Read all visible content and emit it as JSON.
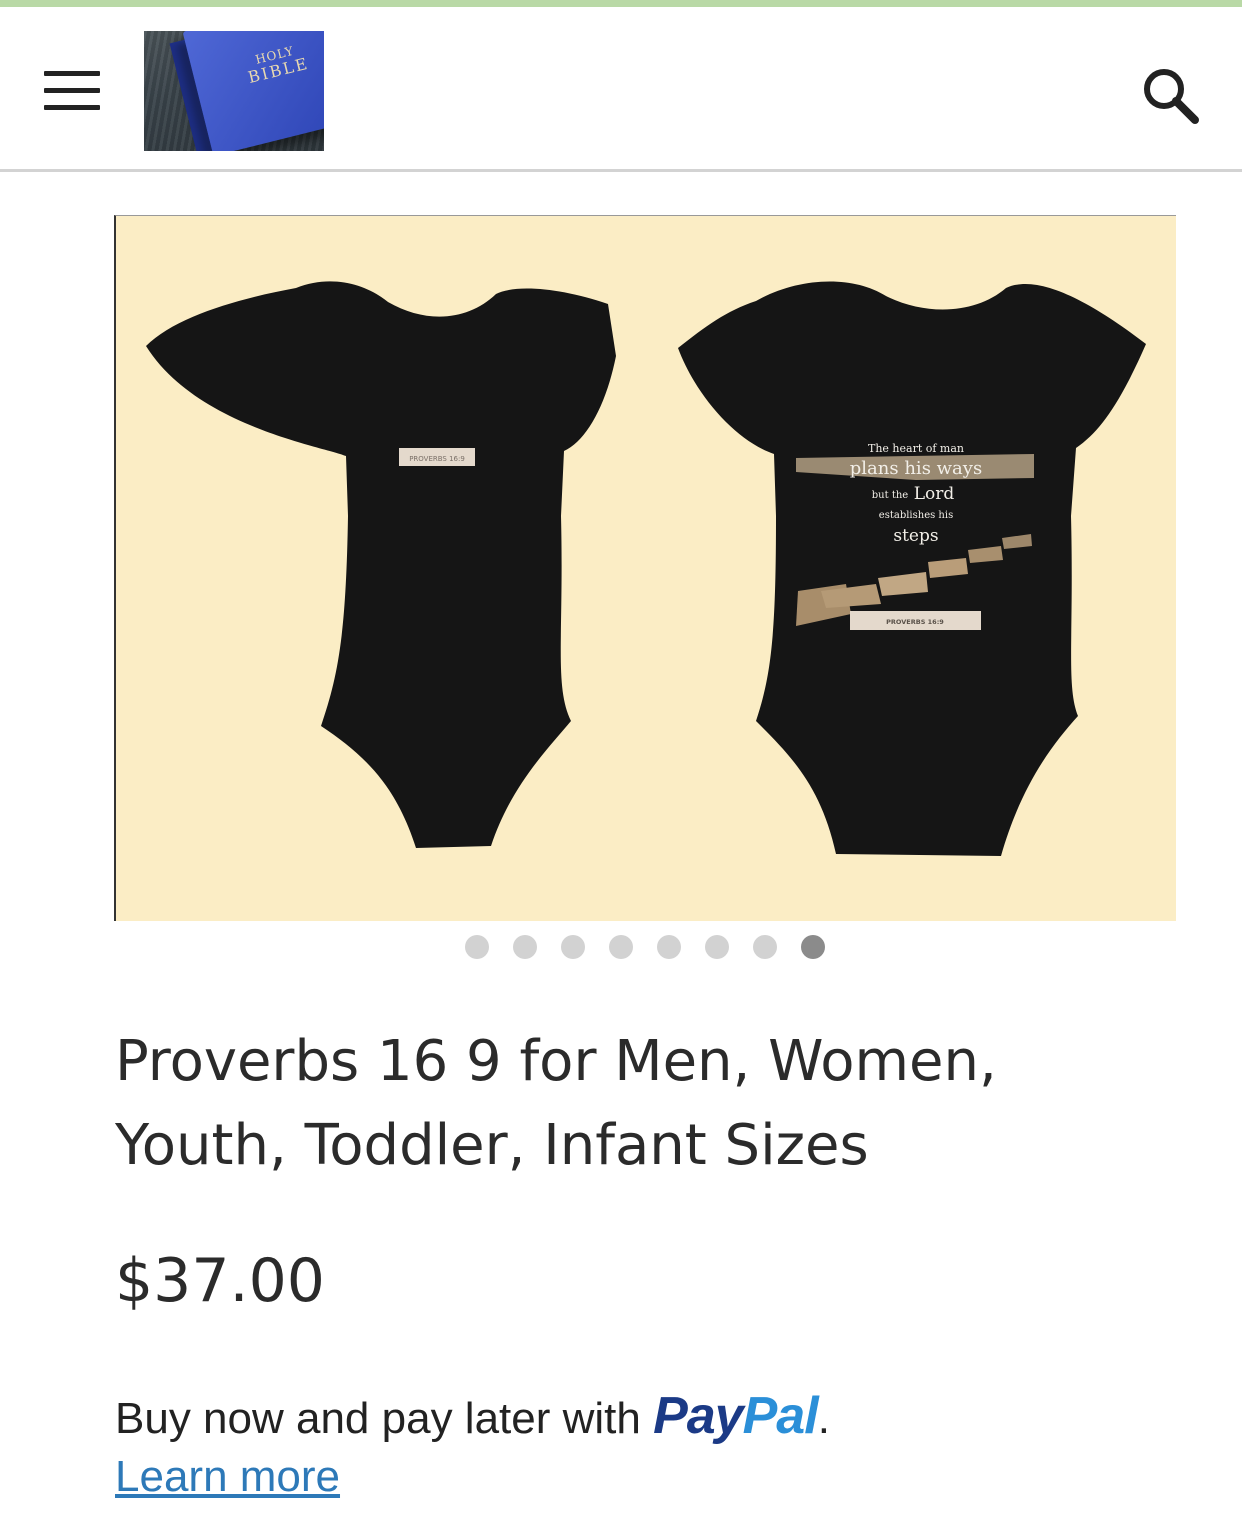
{
  "header": {
    "menu_icon": "hamburger-menu-icon",
    "logo": {
      "line1": "HOLY",
      "line2": "BIBLE"
    },
    "search_icon": "search-icon"
  },
  "carousel": {
    "slide_count": 8,
    "active_index": 7,
    "front_label": "PROVERBS 16:9",
    "back_print": {
      "line1": "The heart of man",
      "line2": "plans his ways",
      "line3_small": "but the",
      "line3_big": "Lord",
      "line4": "establishes his",
      "line5": "steps",
      "label": "PROVERBS 16:9"
    }
  },
  "product": {
    "title": "Proverbs 16 9 for Men, Women, Youth, Toddler, Infant Sizes",
    "price": "$37.00"
  },
  "paypal": {
    "message": "Buy now and pay later with",
    "brand_part1": "Pay",
    "brand_part2": "Pal",
    "suffix": ".",
    "learn_more": "Learn more"
  },
  "colors": {
    "accent_bar": "#b9d9a6",
    "carousel_bg": "#fbedc5",
    "paypal_dark": "#1b3a86",
    "paypal_light": "#2b8fd8",
    "link": "#2d79b8"
  }
}
